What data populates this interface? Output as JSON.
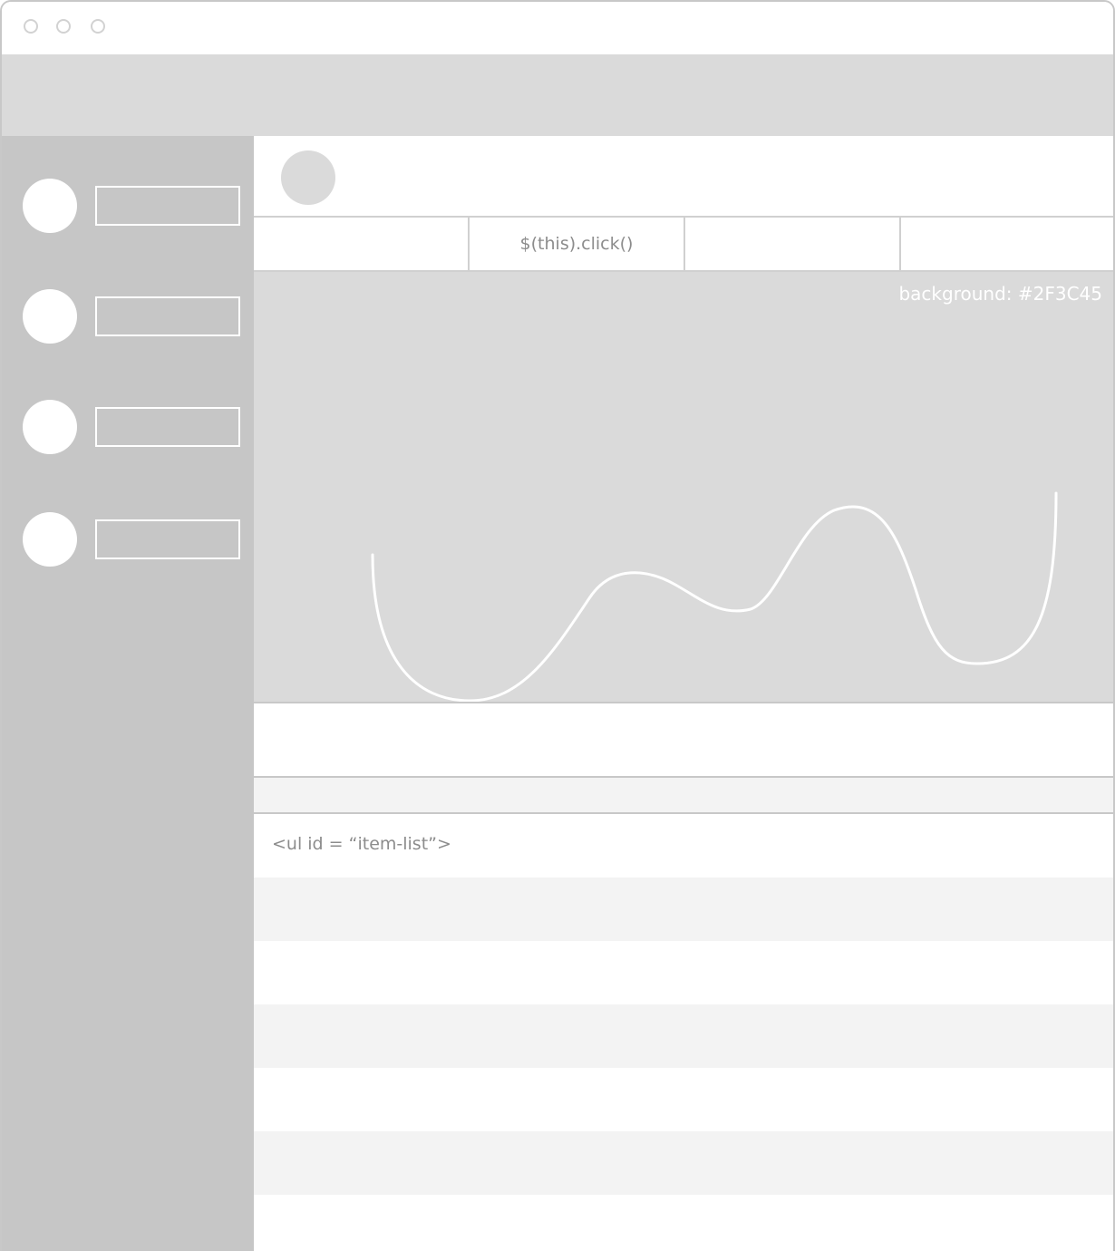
{
  "tabs": [
    {
      "label": ""
    },
    {
      "label": "$(this).click()"
    },
    {
      "label": ""
    },
    {
      "label": ""
    }
  ],
  "chart": {
    "note": "background: #2F3C45",
    "line_color": "#ffffff"
  },
  "list": {
    "caption": "<ul id = “item-list”>",
    "row_count": 6
  },
  "colors": {
    "toolbar": "#dadada",
    "sidebar": "#c6c6c6",
    "panel": "#dadada",
    "row_alt": "#f3f3f3"
  }
}
